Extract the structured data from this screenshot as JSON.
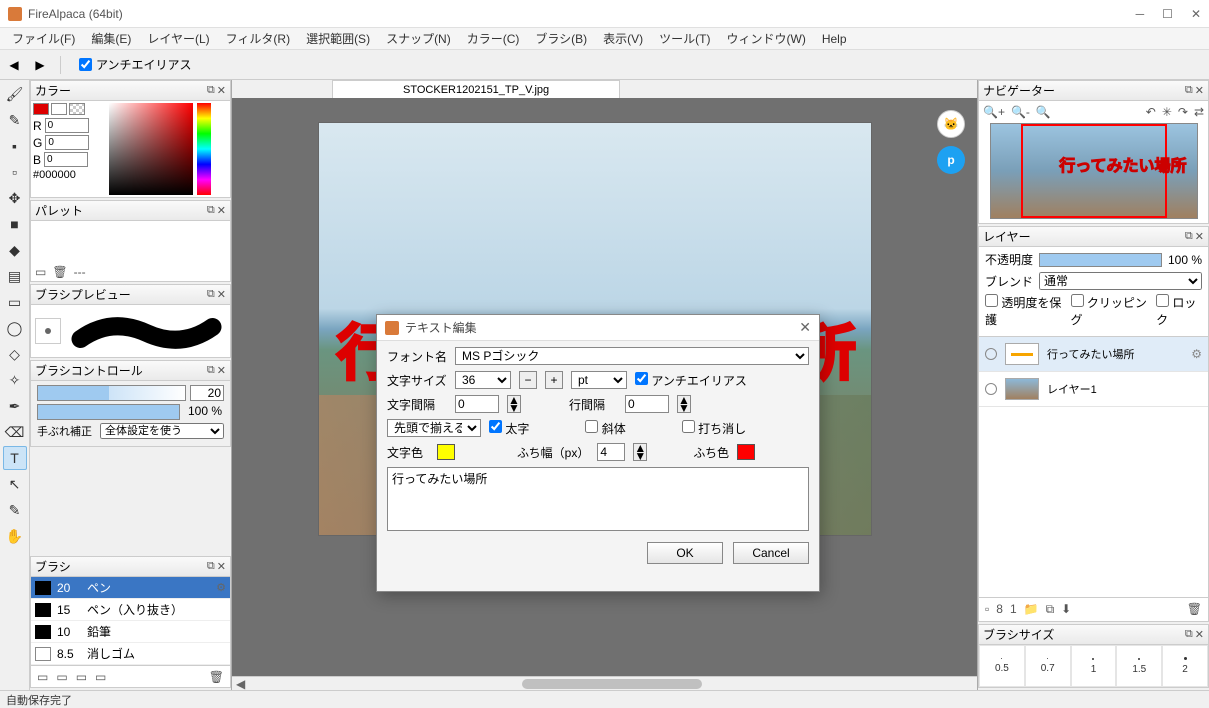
{
  "app": {
    "title": "FireAlpaca (64bit)"
  },
  "menu": [
    "ファイル(F)",
    "編集(E)",
    "レイヤー(L)",
    "フィルタ(R)",
    "選択範囲(S)",
    "スナップ(N)",
    "カラー(C)",
    "ブラシ(B)",
    "表示(V)",
    "ツール(T)",
    "ウィンドウ(W)",
    "Help"
  ],
  "toolbar": {
    "antialias": "アンチエイリアス"
  },
  "doc": {
    "tab": "STOCKER1202151_TP_V.jpg"
  },
  "canvas": {
    "text": "行ってみたい場所"
  },
  "panels": {
    "color": {
      "title": "カラー",
      "r_label": "R",
      "g_label": "G",
      "b_label": "B",
      "r_val": "0",
      "g_val": "0",
      "b_val": "0",
      "hex": "#000000"
    },
    "palette": {
      "title": "パレット"
    },
    "brush_preview": {
      "title": "ブラシプレビュー"
    },
    "brush_control": {
      "title": "ブラシコントロール",
      "size_val": "20",
      "opacity_val": "100 %",
      "stabilize_label": "手ぶれ補正",
      "stabilize_opt": "全体設定を使う"
    },
    "brush": {
      "title": "ブラシ",
      "items": [
        {
          "size": "20",
          "name": "ペン",
          "sel": true
        },
        {
          "size": "15",
          "name": "ペン（入り抜き）"
        },
        {
          "size": "10",
          "name": "鉛筆"
        },
        {
          "size": "8.5",
          "name": "消しゴム"
        }
      ]
    },
    "navigator": {
      "title": "ナビゲーター",
      "thumb_text": "行ってみたい場所"
    },
    "layer": {
      "title": "レイヤー",
      "opacity_label": "不透明度",
      "opacity_val": "100 %",
      "blend_label": "ブレンド",
      "blend_val": "通常",
      "opt_alpha": "透明度を保護",
      "opt_clip": "クリッピング",
      "opt_lock": "ロック",
      "items": [
        {
          "name": "行ってみたい場所",
          "sel": true,
          "type": "text"
        },
        {
          "name": "レイヤー1",
          "type": "img"
        }
      ]
    },
    "brushsize": {
      "title": "ブラシサイズ",
      "sizes": [
        "0.5",
        "0.7",
        "1",
        "1.5",
        "2"
      ]
    }
  },
  "dialog": {
    "title": "テキスト編集",
    "font_label": "フォント名",
    "font_val": "MS Pゴシック",
    "size_label": "文字サイズ",
    "size_val": "36",
    "unit_val": "pt",
    "aa_label": "アンチエイリアス",
    "charspace_label": "文字間隔",
    "charspace_val": "0",
    "linespace_label": "行間隔",
    "linespace_val": "0",
    "align_val": "先頭で揃える",
    "bold_label": "太字",
    "italic_label": "斜体",
    "strike_label": "打ち消し",
    "textcolor_label": "文字色",
    "strokewidth_label": "ふち幅（px）",
    "strokewidth_val": "4",
    "strokecolor_label": "ふち色",
    "textarea_val": "行ってみたい場所",
    "ok": "OK",
    "cancel": "Cancel",
    "colors": {
      "text": "#ffff00",
      "stroke": "#ff0000"
    }
  },
  "status": "自動保存完了"
}
